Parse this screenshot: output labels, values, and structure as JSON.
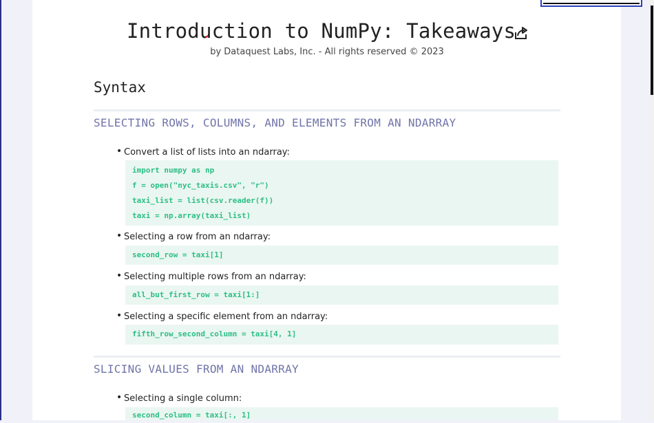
{
  "header": {
    "title": "Introduction to NumPy: Takeaways",
    "share_icon": "share-icon",
    "subtitle": "by Dataquest Labs, Inc. - All rights reserved © 2023"
  },
  "content": {
    "section_title": "Syntax",
    "sections": [
      {
        "heading": "SELECTING ROWS, COLUMNS, AND ELEMENTS FROM AN NDARRAY",
        "items": [
          {
            "text": "Convert a list of lists into an ndarray:",
            "code": [
              "import numpy as np",
              "f = open(\"nyc_taxis.csv\", \"r\")",
              "taxi_list = list(csv.reader(f))",
              "taxi = np.array(taxi_list)"
            ]
          },
          {
            "text": "Selecting a row from an ndarray:",
            "code": [
              "second_row = taxi[1]"
            ]
          },
          {
            "text": "Selecting multiple rows from an ndarray:",
            "code": [
              "all_but_first_row = taxi[1:]"
            ]
          },
          {
            "text": "Selecting a specific element from an ndarray:",
            "code": [
              "fifth_row_second_column = taxi[4, 1]"
            ]
          }
        ]
      },
      {
        "heading": "SLICING VALUES FROM AN NDARRAY",
        "items": [
          {
            "text": "Selecting a single column:",
            "code": [
              "second_column = taxi[:, 1]"
            ]
          }
        ]
      }
    ]
  }
}
